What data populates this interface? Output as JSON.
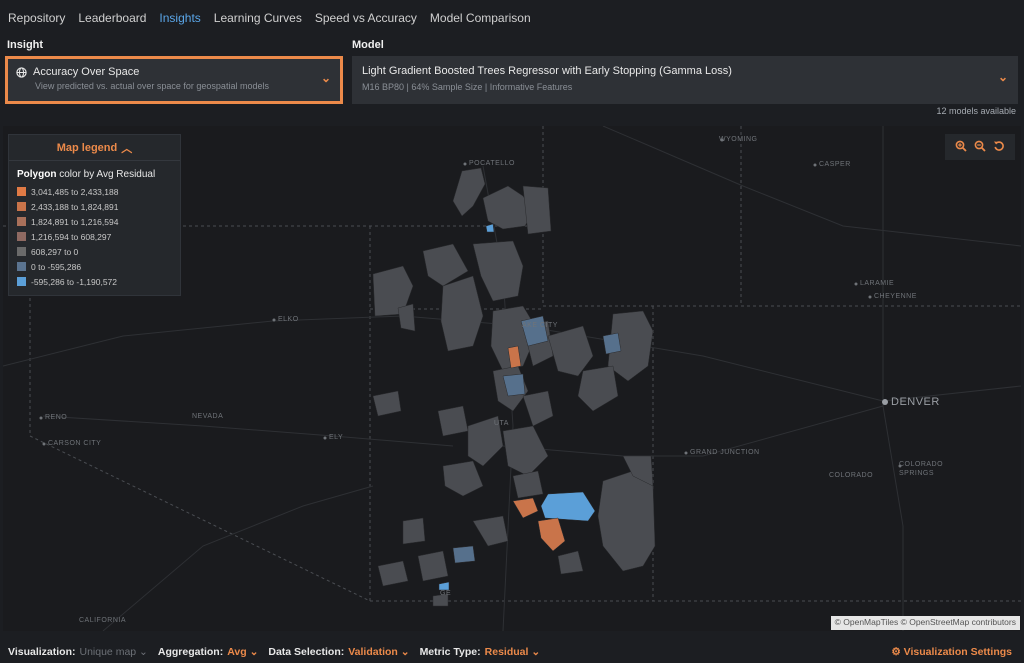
{
  "nav": {
    "items": [
      {
        "label": "Repository",
        "active": false
      },
      {
        "label": "Leaderboard",
        "active": false
      },
      {
        "label": "Insights",
        "active": true
      },
      {
        "label": "Learning Curves",
        "active": false
      },
      {
        "label": "Speed vs Accuracy",
        "active": false
      },
      {
        "label": "Model Comparison",
        "active": false
      }
    ]
  },
  "insight": {
    "section_label": "Insight",
    "title": "Accuracy Over Space",
    "subtitle": "View predicted vs. actual over space for geospatial models",
    "icon": "globe-icon"
  },
  "model": {
    "section_label": "Model",
    "title": "Light Gradient Boosted Trees Regressor with Early Stopping (Gamma Loss)",
    "subtitle": "M16 BP80 | 64% Sample Size | Informative Features",
    "models_available": "12 models available"
  },
  "legend": {
    "header": "Map legend",
    "title_bold": "Polygon",
    "title_rest": " color by Avg Residual",
    "entries": [
      {
        "label": "3,041,485 to 2,433,188",
        "color": "#e07a45"
      },
      {
        "label": "2,433,188 to 1,824,891",
        "color": "#c9744a"
      },
      {
        "label": "1,824,891 to 1,216,594",
        "color": "#a9705a"
      },
      {
        "label": "1,216,594 to 608,297",
        "color": "#8f6a62"
      },
      {
        "label": "608,297 to 0",
        "color": "#6a6a6a"
      },
      {
        "label": "0 to -595,286",
        "color": "#5b7490"
      },
      {
        "label": "-595,286 to -1,190,572",
        "color": "#5b9fd8"
      }
    ]
  },
  "map": {
    "cities": {
      "wyoming": "WYOMING",
      "pocatello": "POCATELLO",
      "casper": "CASPER",
      "laramie": "LARAMIE",
      "cheyenne": "CHEYENNE",
      "elko": "ELKO",
      "reno": "RENO",
      "nevada": "NEVADA",
      "carson_city": "CARSON CITY",
      "ely": "ELY",
      "denver": "DENVER",
      "grand_junction": "GRAND JUNCTION",
      "colorado": "COLORADO",
      "colorado_springs_1": "COLORADO",
      "colorado_springs_2": "SPRINGS",
      "california": "CALIFORNIA",
      "salt_lake_city": "AKE CITY",
      "utah": "UTA",
      "ge": "GE"
    },
    "attribution": "© OpenMapTiles © OpenStreetMap contributors"
  },
  "bottom": {
    "visualization_label": "Visualization:",
    "visualization_value": "Unique map",
    "aggregation_label": "Aggregation:",
    "aggregation_value": "Avg",
    "data_selection_label": "Data Selection:",
    "data_selection_value": "Validation",
    "metric_type_label": "Metric Type:",
    "metric_type_value": "Residual",
    "settings_label": "Visualization Settings"
  }
}
